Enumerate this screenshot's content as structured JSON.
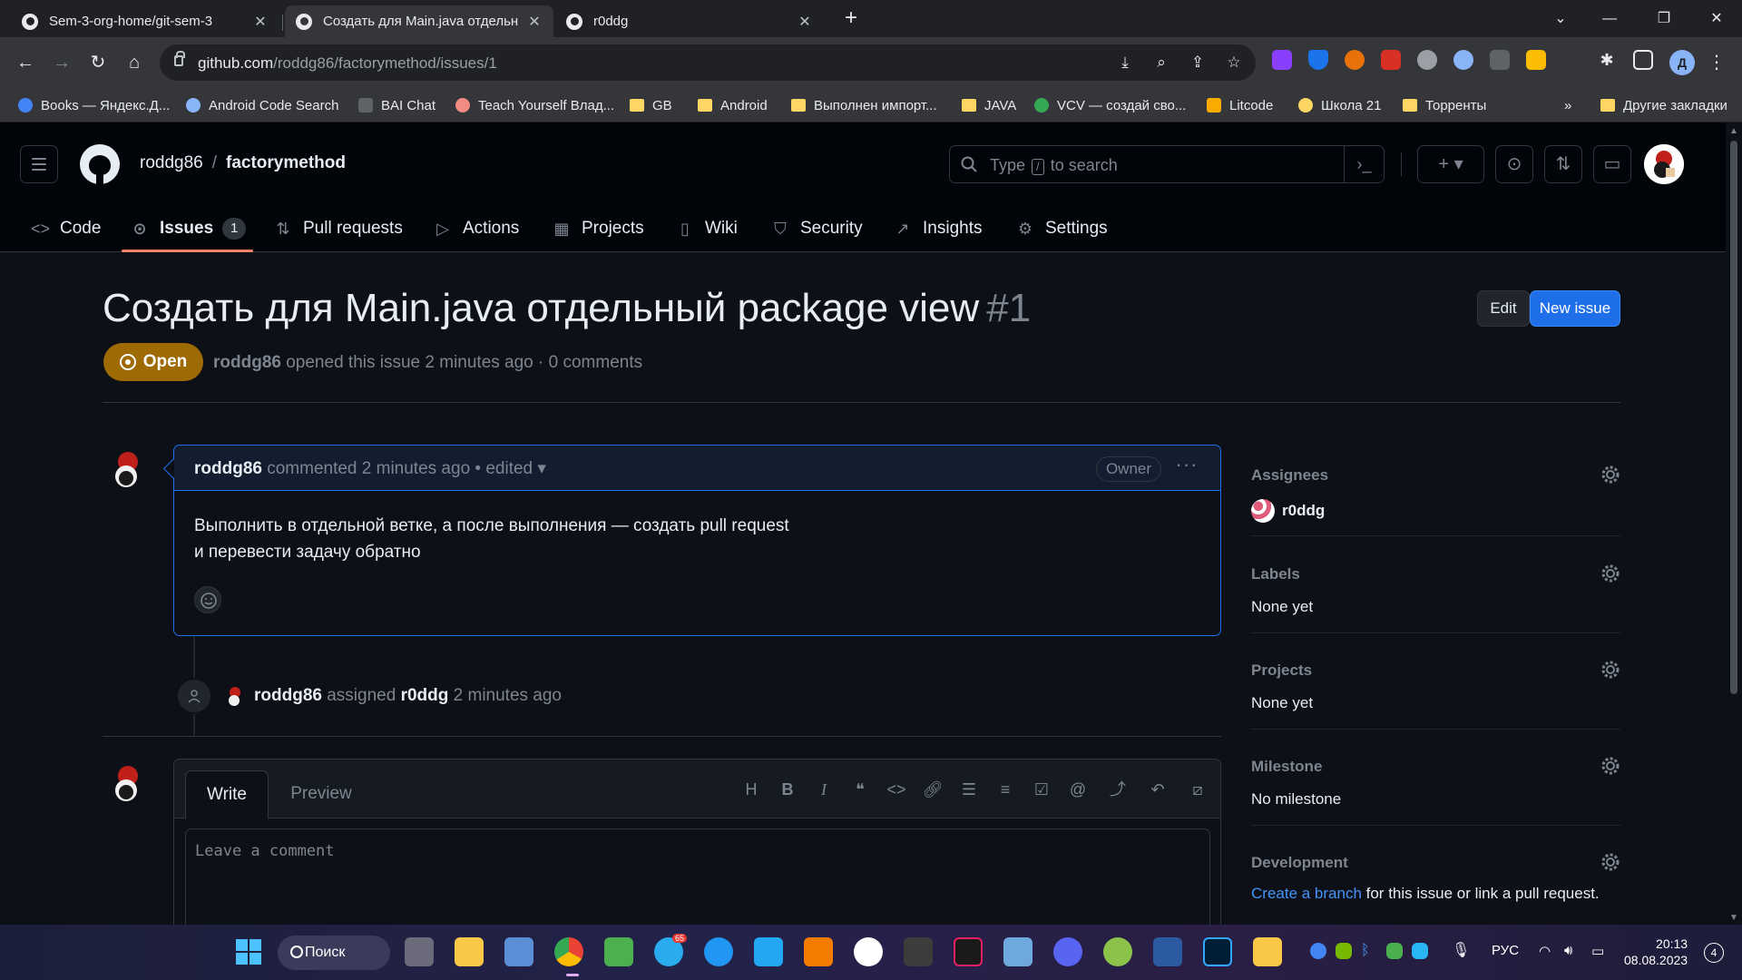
{
  "browser": {
    "tabs": [
      {
        "title": "Sem-3-org-home/git-sem-3",
        "active": false
      },
      {
        "title": "Создать для Main.java отдельны",
        "active": true
      },
      {
        "title": "r0ddg",
        "active": false
      }
    ],
    "url_host": "github.com",
    "url_path": "/roddg86/factorymethod/issues/1",
    "profile_letter": "Д",
    "bookmarks": [
      "Books — Яндекс.Д...",
      "Android Code Search",
      "BAI Chat",
      "Teach Yourself Влад...",
      "GB",
      "Android",
      "Выполнен импорт...",
      "JAVA",
      "VCV — создай сво...",
      "Litcode",
      "Школа 21",
      "Торренты"
    ],
    "bookmarks_more": "»",
    "other_bookmarks": "Другие закладки"
  },
  "github": {
    "owner": "roddg86",
    "separator": "/",
    "repo": "factorymethod",
    "search_prefix": "Type",
    "search_key": "/",
    "search_suffix": "to search",
    "nav": [
      {
        "label": "Code",
        "icon": "code-icon"
      },
      {
        "label": "Issues",
        "icon": "issue-icon",
        "count": "1"
      },
      {
        "label": "Pull requests",
        "icon": "pull-request-icon"
      },
      {
        "label": "Actions",
        "icon": "play-icon"
      },
      {
        "label": "Projects",
        "icon": "table-icon"
      },
      {
        "label": "Wiki",
        "icon": "book-icon"
      },
      {
        "label": "Security",
        "icon": "shield-icon"
      },
      {
        "label": "Insights",
        "icon": "graph-icon"
      },
      {
        "label": "Settings",
        "icon": "gear-icon"
      }
    ]
  },
  "issue": {
    "title": "Создать для Main.java отдельный package view",
    "number": "#1",
    "edit_label": "Edit",
    "new_issue_label": "New issue",
    "state": "Open",
    "author": "roddg86",
    "meta_rest": "opened this issue 2 minutes ago · 0 comments",
    "comment": {
      "author": "roddg86",
      "meta": "commented 2 minutes ago • edited",
      "role": "Owner",
      "lines": [
        "Выполнить в отдельной ветке, а после выполнения — создать pull request",
        "и перевести задачу обратно"
      ]
    },
    "event": {
      "actor": "roddg86",
      "action": "assigned",
      "target": "r0ddg",
      "time": "2 minutes ago"
    },
    "editor": {
      "write_tab": "Write",
      "preview_tab": "Preview",
      "placeholder": "Leave a comment",
      "tools": [
        "H",
        "B",
        "I"
      ]
    }
  },
  "sidebar": {
    "assignees_label": "Assignees",
    "assignee": "r0ddg",
    "labels_label": "Labels",
    "labels_value": "None yet",
    "projects_label": "Projects",
    "projects_value": "None yet",
    "milestone_label": "Milestone",
    "milestone_value": "No milestone",
    "development_label": "Development",
    "development_link": "Create a branch",
    "development_rest": " for this issue or link a pull request."
  },
  "taskbar": {
    "search_label": "Поиск",
    "telegram_badge": "65",
    "lang": "РУС",
    "time": "20:13",
    "date": "08.08.2023",
    "notifications": "4"
  },
  "colors": {
    "open_state": "#9e6a03",
    "primary_button": "#1f6feb",
    "link": "#4493f8",
    "underline": "#f78166"
  }
}
